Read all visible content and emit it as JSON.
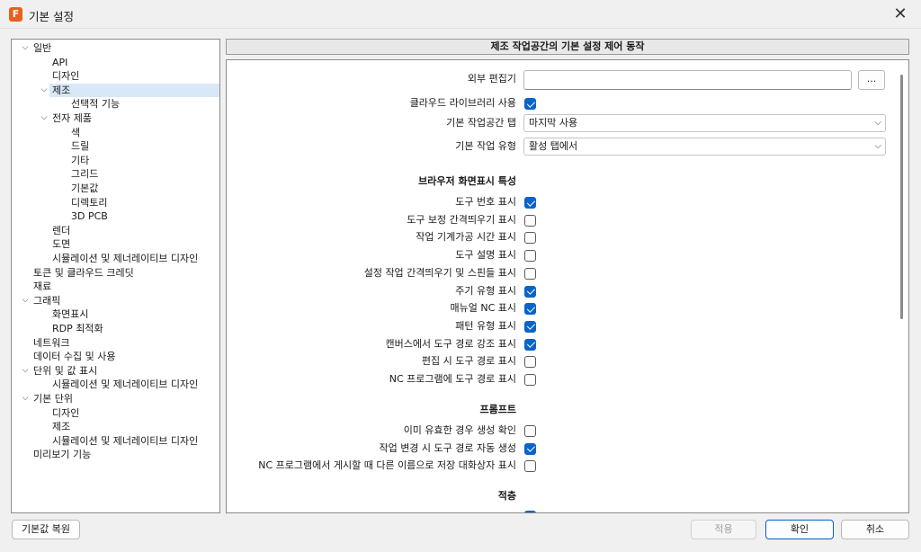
{
  "window": {
    "title": "기본 설정",
    "app_icon_letter": "F"
  },
  "tree": {
    "items": [
      {
        "label": "일반",
        "arrow": true
      },
      {
        "label": "API",
        "arrow": false
      },
      {
        "label": "디자인",
        "arrow": false
      },
      {
        "label": "제조",
        "arrow": true,
        "selected": true
      },
      {
        "label": "선택적 기능",
        "arrow": false
      },
      {
        "label": "전자 제품",
        "arrow": true
      },
      {
        "label": "색",
        "arrow": false
      },
      {
        "label": "드릴",
        "arrow": false
      },
      {
        "label": "기타",
        "arrow": false
      },
      {
        "label": "그리드",
        "arrow": false
      },
      {
        "label": "기본값",
        "arrow": false
      },
      {
        "label": "디렉토리",
        "arrow": false
      },
      {
        "label": "3D PCB",
        "arrow": false
      },
      {
        "label": "렌더",
        "arrow": false
      },
      {
        "label": "도면",
        "arrow": false
      },
      {
        "label": "시뮬레이션 및 제너레이티브 디자인",
        "arrow": false
      },
      {
        "label": "토큰 및 클라우드 크레딧",
        "arrow": false
      },
      {
        "label": "재료",
        "arrow": false
      },
      {
        "label": "그래픽",
        "arrow": true
      },
      {
        "label": "화면표시",
        "arrow": false
      },
      {
        "label": "RDP 최적화",
        "arrow": false
      },
      {
        "label": "네트워크",
        "arrow": false
      },
      {
        "label": "데이터 수집 및 사용",
        "arrow": false
      },
      {
        "label": "단위 및 값 표시",
        "arrow": true
      },
      {
        "label": "시뮬레이션 및 제너레이티브 디자인",
        "arrow": false
      },
      {
        "label": "기본 단위",
        "arrow": true
      },
      {
        "label": "디자인",
        "arrow": false
      },
      {
        "label": "제조",
        "arrow": false
      },
      {
        "label": "시뮬레이션 및 제너레이티브 디자인",
        "arrow": false
      },
      {
        "label": "미리보기 기능",
        "arrow": false
      }
    ]
  },
  "header": {
    "title": "제조 작업공간의 기본 설정 제어 동작"
  },
  "settings": {
    "external_editor": {
      "label": "외부 편집기",
      "value": "",
      "browse_label": "..."
    },
    "cloud_library": {
      "label": "클라우드 라이브러리 사용",
      "checked": true
    },
    "default_workspace_tab": {
      "label": "기본 작업공간 탭",
      "value": "마지막 사용"
    },
    "default_job_type": {
      "label": "기본 작업 유형",
      "value": "활성 탭에서"
    }
  },
  "browser_section": {
    "title": "브라우저 화면표시 특성",
    "items": [
      {
        "label": "도구 번호 표시",
        "checked": true
      },
      {
        "label": "도구 보정 간격띄우기 표시",
        "checked": false
      },
      {
        "label": "작업 기계가공 시간 표시",
        "checked": false
      },
      {
        "label": "도구 설명 표시",
        "checked": false
      },
      {
        "label": "설정 작업 간격띄우기 및 스핀들 표시",
        "checked": false
      },
      {
        "label": "주기 유형 표시",
        "checked": true
      },
      {
        "label": "매뉴얼 NC 표시",
        "checked": true
      },
      {
        "label": "패턴 유형 표시",
        "checked": true
      },
      {
        "label": "캔버스에서 도구 경로 강조 표시",
        "checked": true
      },
      {
        "label": "편집 시 도구 경로 표시",
        "checked": false
      },
      {
        "label": "NC 프로그램에 도구 경로 표시",
        "checked": false
      }
    ]
  },
  "prompt_section": {
    "title": "프롬프트",
    "items": [
      {
        "label": "이미 유효한 경우 생성 확인",
        "checked": false
      },
      {
        "label": "작업 변경 시 도구 경로 자동 생성",
        "checked": true
      },
      {
        "label": "NC 프로그램에서 게시할 때 다른 이름으로 저장 대화상자 표시",
        "checked": false
      }
    ]
  },
  "stacking_section": {
    "title": "적층"
  },
  "footer": {
    "restore_label": "기본값 복원",
    "apply_label": "적용",
    "ok_label": "확인",
    "cancel_label": "취소"
  },
  "colors": {
    "accent": "#0a64c8",
    "selected_bg": "#d9e8f7",
    "app_icon": "#e8601c"
  }
}
